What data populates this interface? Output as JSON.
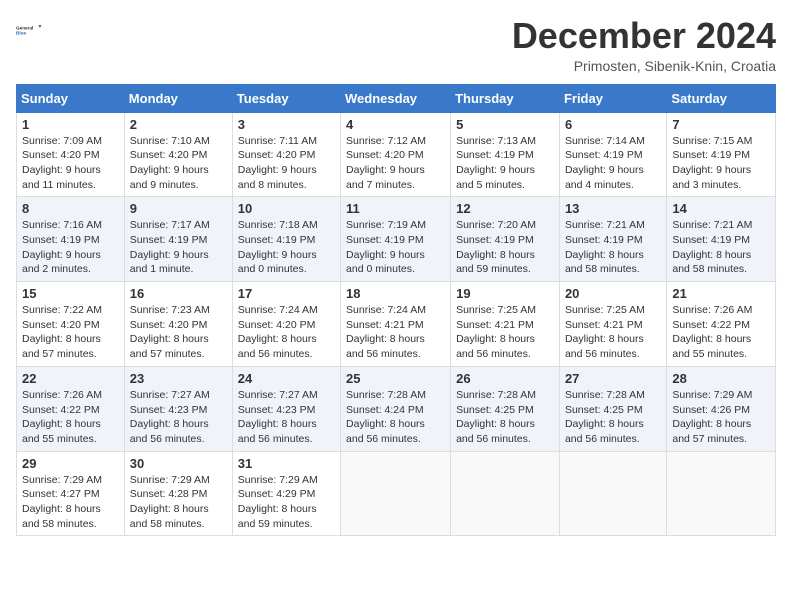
{
  "logo": {
    "line1": "General",
    "line2": "Blue"
  },
  "title": "December 2024",
  "subtitle": "Primosten, Sibenik-Knin, Croatia",
  "days_header": [
    "Sunday",
    "Monday",
    "Tuesday",
    "Wednesday",
    "Thursday",
    "Friday",
    "Saturday"
  ],
  "weeks": [
    [
      {
        "day": "1",
        "sunrise": "7:09 AM",
        "sunset": "4:20 PM",
        "daylight": "9 hours and 11 minutes."
      },
      {
        "day": "2",
        "sunrise": "7:10 AM",
        "sunset": "4:20 PM",
        "daylight": "9 hours and 9 minutes."
      },
      {
        "day": "3",
        "sunrise": "7:11 AM",
        "sunset": "4:20 PM",
        "daylight": "9 hours and 8 minutes."
      },
      {
        "day": "4",
        "sunrise": "7:12 AM",
        "sunset": "4:20 PM",
        "daylight": "9 hours and 7 minutes."
      },
      {
        "day": "5",
        "sunrise": "7:13 AM",
        "sunset": "4:19 PM",
        "daylight": "9 hours and 5 minutes."
      },
      {
        "day": "6",
        "sunrise": "7:14 AM",
        "sunset": "4:19 PM",
        "daylight": "9 hours and 4 minutes."
      },
      {
        "day": "7",
        "sunrise": "7:15 AM",
        "sunset": "4:19 PM",
        "daylight": "9 hours and 3 minutes."
      }
    ],
    [
      {
        "day": "8",
        "sunrise": "7:16 AM",
        "sunset": "4:19 PM",
        "daylight": "9 hours and 2 minutes."
      },
      {
        "day": "9",
        "sunrise": "7:17 AM",
        "sunset": "4:19 PM",
        "daylight": "9 hours and 1 minute."
      },
      {
        "day": "10",
        "sunrise": "7:18 AM",
        "sunset": "4:19 PM",
        "daylight": "9 hours and 0 minutes."
      },
      {
        "day": "11",
        "sunrise": "7:19 AM",
        "sunset": "4:19 PM",
        "daylight": "9 hours and 0 minutes."
      },
      {
        "day": "12",
        "sunrise": "7:20 AM",
        "sunset": "4:19 PM",
        "daylight": "8 hours and 59 minutes."
      },
      {
        "day": "13",
        "sunrise": "7:21 AM",
        "sunset": "4:19 PM",
        "daylight": "8 hours and 58 minutes."
      },
      {
        "day": "14",
        "sunrise": "7:21 AM",
        "sunset": "4:19 PM",
        "daylight": "8 hours and 58 minutes."
      }
    ],
    [
      {
        "day": "15",
        "sunrise": "7:22 AM",
        "sunset": "4:20 PM",
        "daylight": "8 hours and 57 minutes."
      },
      {
        "day": "16",
        "sunrise": "7:23 AM",
        "sunset": "4:20 PM",
        "daylight": "8 hours and 57 minutes."
      },
      {
        "day": "17",
        "sunrise": "7:24 AM",
        "sunset": "4:20 PM",
        "daylight": "8 hours and 56 minutes."
      },
      {
        "day": "18",
        "sunrise": "7:24 AM",
        "sunset": "4:21 PM",
        "daylight": "8 hours and 56 minutes."
      },
      {
        "day": "19",
        "sunrise": "7:25 AM",
        "sunset": "4:21 PM",
        "daylight": "8 hours and 56 minutes."
      },
      {
        "day": "20",
        "sunrise": "7:25 AM",
        "sunset": "4:21 PM",
        "daylight": "8 hours and 56 minutes."
      },
      {
        "day": "21",
        "sunrise": "7:26 AM",
        "sunset": "4:22 PM",
        "daylight": "8 hours and 55 minutes."
      }
    ],
    [
      {
        "day": "22",
        "sunrise": "7:26 AM",
        "sunset": "4:22 PM",
        "daylight": "8 hours and 55 minutes."
      },
      {
        "day": "23",
        "sunrise": "7:27 AM",
        "sunset": "4:23 PM",
        "daylight": "8 hours and 56 minutes."
      },
      {
        "day": "24",
        "sunrise": "7:27 AM",
        "sunset": "4:23 PM",
        "daylight": "8 hours and 56 minutes."
      },
      {
        "day": "25",
        "sunrise": "7:28 AM",
        "sunset": "4:24 PM",
        "daylight": "8 hours and 56 minutes."
      },
      {
        "day": "26",
        "sunrise": "7:28 AM",
        "sunset": "4:25 PM",
        "daylight": "8 hours and 56 minutes."
      },
      {
        "day": "27",
        "sunrise": "7:28 AM",
        "sunset": "4:25 PM",
        "daylight": "8 hours and 56 minutes."
      },
      {
        "day": "28",
        "sunrise": "7:29 AM",
        "sunset": "4:26 PM",
        "daylight": "8 hours and 57 minutes."
      }
    ],
    [
      {
        "day": "29",
        "sunrise": "7:29 AM",
        "sunset": "4:27 PM",
        "daylight": "8 hours and 58 minutes."
      },
      {
        "day": "30",
        "sunrise": "7:29 AM",
        "sunset": "4:28 PM",
        "daylight": "8 hours and 58 minutes."
      },
      {
        "day": "31",
        "sunrise": "7:29 AM",
        "sunset": "4:29 PM",
        "daylight": "8 hours and 59 minutes."
      },
      null,
      null,
      null,
      null
    ]
  ],
  "labels": {
    "sunrise": "Sunrise:",
    "sunset": "Sunset:",
    "daylight": "Daylight:"
  }
}
